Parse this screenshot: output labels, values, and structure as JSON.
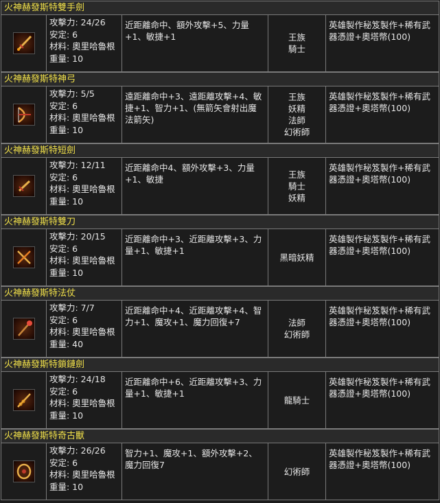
{
  "items": [
    {
      "title": "火神赫發斯特雙手劍",
      "icon": "two-handed-sword-icon",
      "stats": [
        "攻擊力: 24/26",
        "安定: 6",
        "材料: 奧里哈魯根",
        "重量: 10"
      ],
      "effect": "近距離命中、額外攻擊+5、力量+1、敏捷+1",
      "classes": [
        "王族",
        "騎士"
      ],
      "source": "英雄製作秘笈製作+稀有武器憑證+奧塔幣(100)"
    },
    {
      "title": "火神赫發斯特神弓",
      "icon": "bow-icon",
      "stats": [
        "攻擊力: 5/5",
        "安定: 6",
        "材料: 奧里哈魯根",
        "重量: 10"
      ],
      "effect": "遠距離命中+3、遠距離攻擊+4、敏捷+1、智力+1、(無箭矢會射出魔法箭矢)",
      "classes": [
        "王族",
        "妖精",
        "法師",
        "幻術師"
      ],
      "source": "英雄製作秘笈製作+稀有武器憑證+奧塔幣(100)"
    },
    {
      "title": "火神赫發斯特短劍",
      "icon": "short-sword-icon",
      "stats": [
        "攻擊力: 12/11",
        "安定: 6",
        "材料: 奧里哈魯根",
        "重量: 10"
      ],
      "effect": "近距離命中4、額外攻擊+3、力量+1、敏捷",
      "classes": [
        "王族",
        "騎士",
        "妖精"
      ],
      "source": "英雄製作秘笈製作+稀有武器憑證+奧塔幣(100)"
    },
    {
      "title": "火神赫發斯特雙刀",
      "icon": "dual-blades-icon",
      "stats": [
        "攻擊力: 20/15",
        "安定: 6",
        "材料: 奧里哈魯根",
        "重量: 10"
      ],
      "effect": "近距離命中+3、近距離攻擊+3、力量+1、敏捷+1",
      "classes": [
        "黑暗妖精"
      ],
      "source": "英雄製作秘笈製作+稀有武器憑證+奧塔幣(100)"
    },
    {
      "title": "火神赫發斯特法仗",
      "icon": "staff-icon",
      "stats": [
        "攻擊力: 7/7",
        "安定: 6",
        "材料: 奧里哈魯根",
        "重量: 40"
      ],
      "effect": "近距離命中+4、近距離攻擊+4、智力+1、魔攻+1、魔力回復+7",
      "classes": [
        "法師",
        "幻術師"
      ],
      "source": "英雄製作秘笈製作+稀有武器憑證+奧塔幣(100)"
    },
    {
      "title": "火神赫發斯特鎖鏈劍",
      "icon": "chain-sword-icon",
      "stats": [
        "攻擊力: 24/18",
        "安定: 6",
        "材料: 奧里哈魯根",
        "重量: 10"
      ],
      "effect": "近距離命中+6、近距離攻擊+3、力量+1、敏捷+1",
      "classes": [
        "龍騎士"
      ],
      "source": "英雄製作秘笈製作+稀有武器憑證+奧塔幣(100)"
    },
    {
      "title": "火神赫發斯特奇古獸",
      "icon": "kiringku-icon",
      "stats": [
        "攻擊力: 26/26",
        "安定: 6",
        "材料: 奧里哈魯根",
        "重量: 10"
      ],
      "effect": "智力+1、魔攻+1、額外攻擊+2、魔力回復7",
      "classes": [
        "幻術師"
      ],
      "source": "英雄製作秘笈製作+稀有武器憑證+奧塔幣(100)"
    }
  ]
}
